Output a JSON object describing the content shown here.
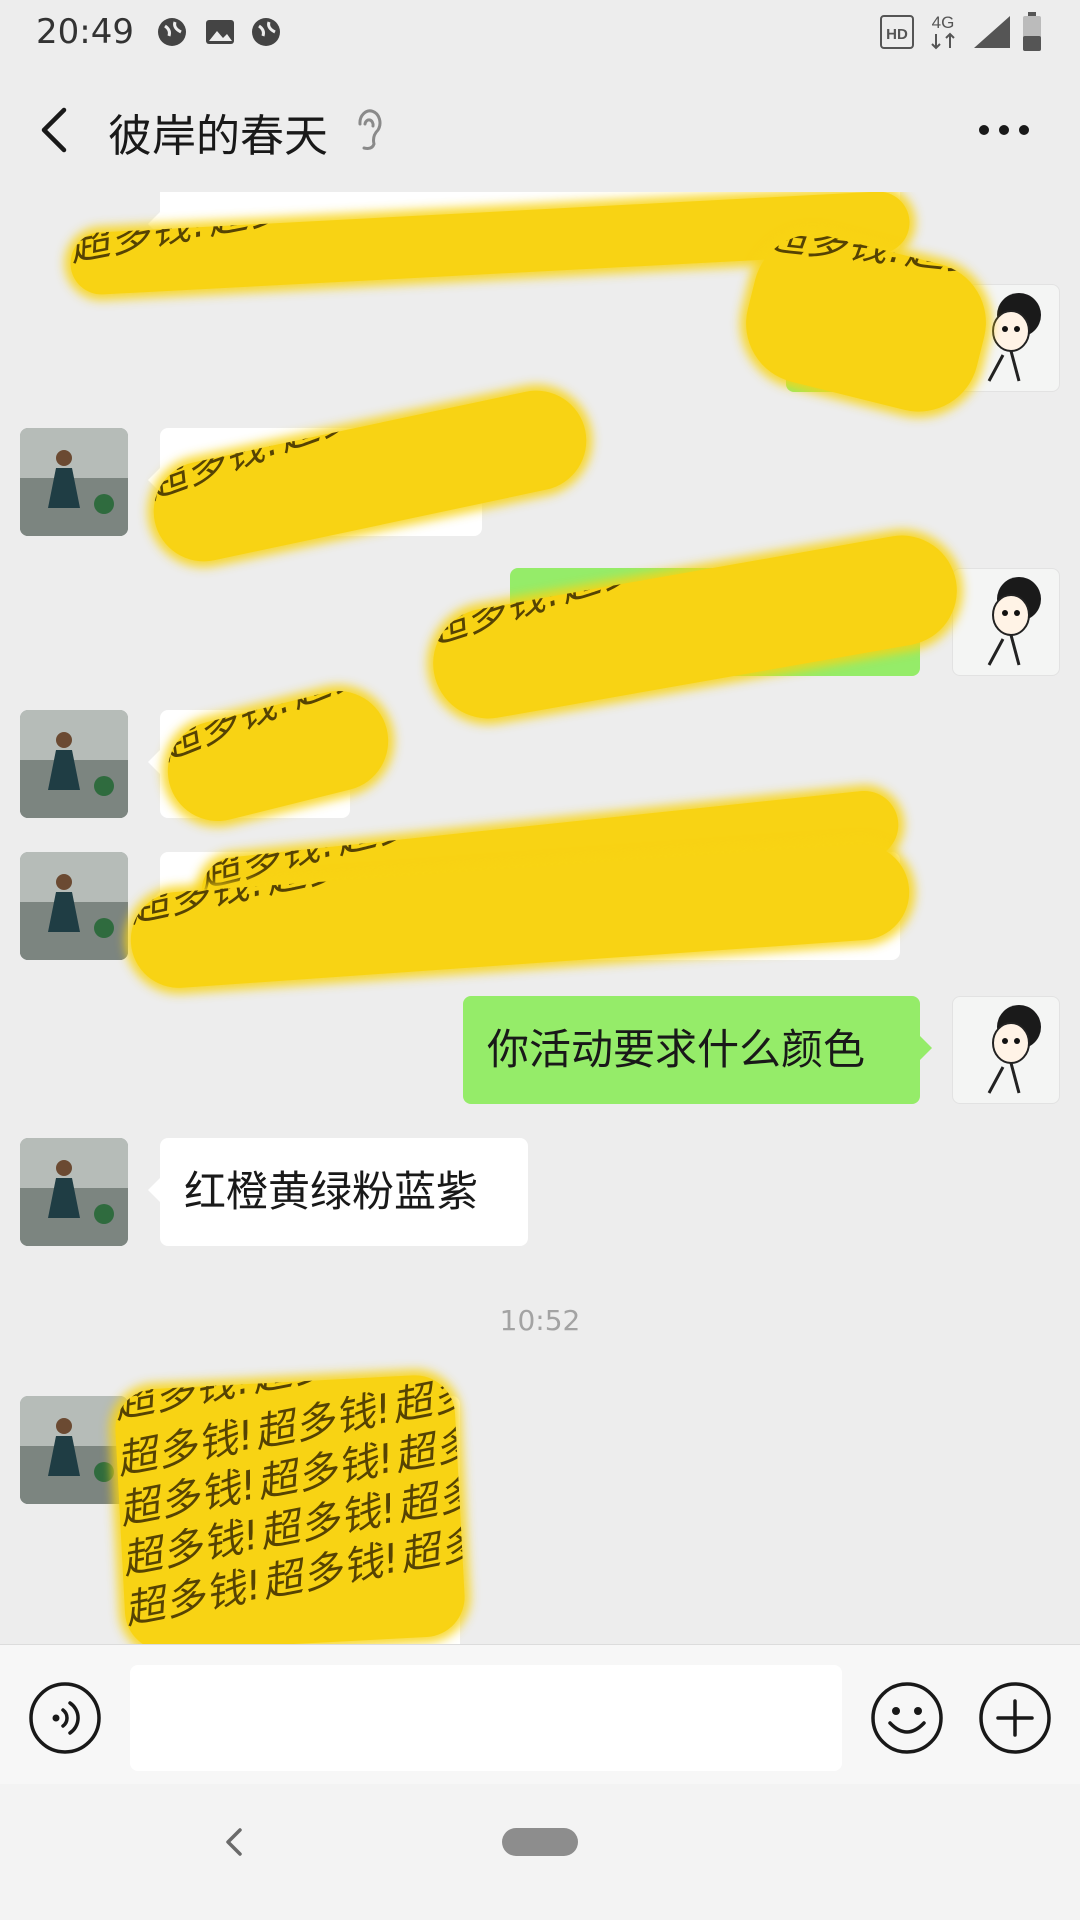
{
  "status_bar": {
    "time": "20:49",
    "icons": [
      "globe-icon",
      "image-icon",
      "globe-icon",
      "hd-icon",
      "4g-icon",
      "signal-icon",
      "battery-icon"
    ],
    "hd_label": "HD",
    "network_label": "4G"
  },
  "header": {
    "title": "彼岸的春天",
    "back_icon": "chevron-left-icon",
    "ear_icon": "ear-icon",
    "more_icon": "more-icon"
  },
  "messages": [
    {
      "side": "right",
      "type": "redacted"
    },
    {
      "side": "left",
      "type": "redacted"
    },
    {
      "side": "right",
      "type": "redacted"
    },
    {
      "side": "left",
      "type": "redacted"
    },
    {
      "side": "left",
      "type": "redacted"
    },
    {
      "side": "right",
      "type": "text",
      "text": "你活动要求什么颜色"
    },
    {
      "side": "left",
      "type": "text",
      "text": "红橙黄绿粉蓝紫"
    },
    {
      "side": "center",
      "type": "time",
      "text": "10:52"
    },
    {
      "side": "left",
      "type": "redacted"
    }
  ],
  "redaction_pattern": "!超多钱!超多钱!超多钱!超多钱!超多钱!超多钱!",
  "input_bar": {
    "placeholder": "",
    "voice_icon": "voice-icon",
    "emoji_icon": "emoji-icon",
    "plus_icon": "plus-icon"
  },
  "nav_bar": {
    "back_icon": "nav-back-icon",
    "home_icon": "home-pill-icon"
  },
  "colors": {
    "background": "#ededed",
    "green_bubble": "#95ec69",
    "white_bubble": "#ffffff",
    "redaction_yellow": "#f8d314"
  }
}
